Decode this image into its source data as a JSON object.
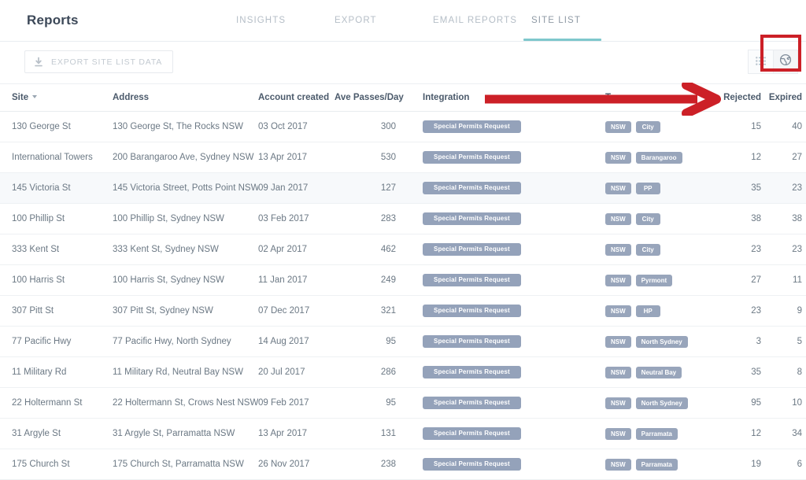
{
  "header": {
    "title": "Reports",
    "tabs": [
      {
        "label": "INSIGHTS",
        "active": false
      },
      {
        "label": "EXPORT",
        "active": false
      },
      {
        "label": "EMAIL REPORTS",
        "active": false
      },
      {
        "label": "SITE LIST",
        "active": true
      }
    ]
  },
  "toolbar": {
    "export_label": "EXPORT SITE LIST DATA",
    "download_icon": "download-icon",
    "list_view_icon": "list-view-icon",
    "map_view_icon": "globe-map-view-icon",
    "active_view": "map"
  },
  "annotation": {
    "arrow_color": "#cc2027",
    "box_color": "#cc2027",
    "points_to": "globe-map-view-icon"
  },
  "colors": {
    "accent_tab_underline": "#7fc8cc",
    "pill": "#94a2ba",
    "tag": "#98a5bb",
    "annotation_red": "#cc2027",
    "row_alt": "#f7f9fb"
  },
  "table": {
    "columns": [
      "Site",
      "Address",
      "Account created",
      "Ave Passes/Day",
      "Integration",
      "Tags",
      "Rejected",
      "Expired"
    ],
    "sorted_by": "Site",
    "rows": [
      {
        "site": "130 George St",
        "address": "130 George St,  The Rocks NSW",
        "created": "03 Oct 2017",
        "passes": "300",
        "integration": "Special Permits Request",
        "tags": [
          "NSW",
          "City"
        ],
        "rejected": "15",
        "expired": "40",
        "alt": false
      },
      {
        "site": "International Towers",
        "address": "200 Barangaroo Ave, Sydney NSW",
        "created": "13 Apr 2017",
        "passes": "530",
        "integration": "Special Permits Request",
        "tags": [
          "NSW",
          "Barangaroo"
        ],
        "rejected": "12",
        "expired": "27",
        "alt": false
      },
      {
        "site": "145 Victoria St",
        "address": "145 Victoria Street, Potts Point NSW",
        "created": "09 Jan 2017",
        "passes": "127",
        "integration": "Special Permits Request",
        "tags": [
          "NSW",
          "PP"
        ],
        "rejected": "35",
        "expired": "23",
        "alt": true
      },
      {
        "site": "100 Phillip St",
        "address": "100 Phillip St, Sydney NSW",
        "created": "03 Feb 2017",
        "passes": "283",
        "integration": "Special Permits Request",
        "tags": [
          "NSW",
          "City"
        ],
        "rejected": "38",
        "expired": "38",
        "alt": false
      },
      {
        "site": "333 Kent St",
        "address": "333 Kent St, Sydney NSW",
        "created": "02 Apr 2017",
        "passes": "462",
        "integration": "Special Permits Request",
        "tags": [
          "NSW",
          "City"
        ],
        "rejected": "23",
        "expired": "23",
        "alt": false
      },
      {
        "site": "100 Harris St",
        "address": "100 Harris St, Sydney NSW",
        "created": "11 Jan 2017",
        "passes": "249",
        "integration": "Special Permits Request",
        "tags": [
          "NSW",
          "Pyrmont"
        ],
        "rejected": "27",
        "expired": "11",
        "alt": false
      },
      {
        "site": "307 Pitt St",
        "address": "307 Pitt St, Sydney NSW",
        "created": "07 Dec 2017",
        "passes": "321",
        "integration": "Special Permits Request",
        "tags": [
          "NSW",
          "HP"
        ],
        "rejected": "23",
        "expired": "9",
        "alt": false
      },
      {
        "site": "77 Pacific Hwy",
        "address": "77 Pacific Hwy, North Sydney",
        "created": "14 Aug 2017",
        "passes": "95",
        "integration": "Special Permits Request",
        "tags": [
          "NSW",
          "North Sydney"
        ],
        "rejected": "3",
        "expired": "5",
        "alt": false
      },
      {
        "site": "11 Military Rd",
        "address": "11 Military Rd, Neutral Bay NSW",
        "created": "20 Jul 2017",
        "passes": "286",
        "integration": "Special Permits Request",
        "tags": [
          "NSW",
          "Neutral Bay"
        ],
        "rejected": "35",
        "expired": "8",
        "alt": false
      },
      {
        "site": "22 Holtermann St",
        "address": "22 Holtermann St, Crows Nest NSW",
        "created": "09 Feb 2017",
        "passes": "95",
        "integration": "Special Permits Request",
        "tags": [
          "NSW",
          "North Sydney"
        ],
        "rejected": "95",
        "expired": "10",
        "alt": false
      },
      {
        "site": "31 Argyle St",
        "address": "31 Argyle St, Parramatta NSW",
        "created": "13 Apr 2017",
        "passes": "131",
        "integration": "Special Permits Request",
        "tags": [
          "NSW",
          "Parramata"
        ],
        "rejected": "12",
        "expired": "34",
        "alt": false
      },
      {
        "site": "175 Church St",
        "address": "175 Church St, Parramatta NSW",
        "created": "26 Nov 2017",
        "passes": "238",
        "integration": "Special Permits Request",
        "tags": [
          "NSW",
          "Parramata"
        ],
        "rejected": "19",
        "expired": "6",
        "alt": false
      }
    ]
  }
}
